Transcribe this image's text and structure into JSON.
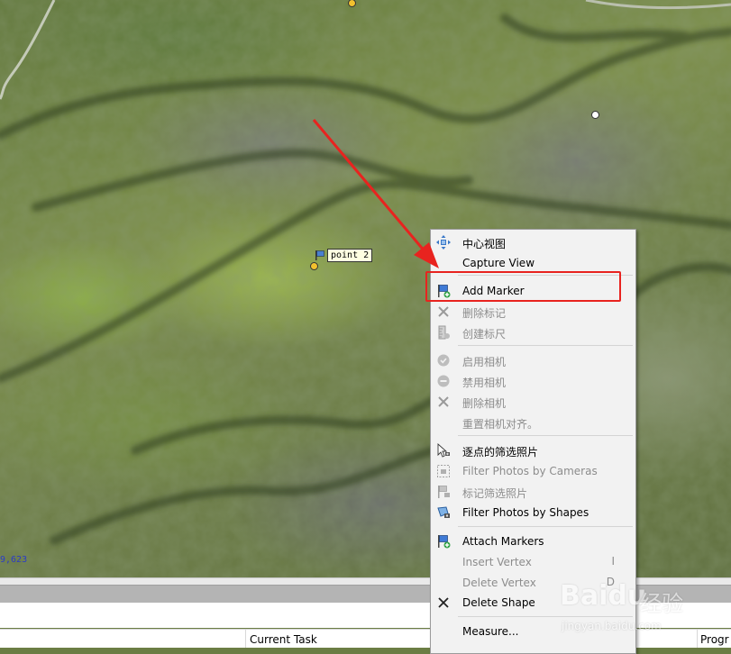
{
  "viewport": {
    "coordinate_readout": "9,623",
    "marker_label": "point 2"
  },
  "context_menu": {
    "items": [
      {
        "label": "中心视图",
        "icon": "center-view-icon",
        "enabled": true
      },
      {
        "label": "Capture View",
        "icon": "",
        "enabled": true
      },
      {
        "label": "Add Marker",
        "icon": "add-marker-icon",
        "enabled": true
      },
      {
        "label": "删除标记",
        "icon": "delete-marker-icon",
        "enabled": false
      },
      {
        "label": "创建标尺",
        "icon": "create-scale-bar-icon",
        "enabled": false
      },
      {
        "label": "启用相机",
        "icon": "enable-camera-icon",
        "enabled": false
      },
      {
        "label": "禁用相机",
        "icon": "disable-camera-icon",
        "enabled": false
      },
      {
        "label": "删除相机",
        "icon": "delete-camera-icon",
        "enabled": false
      },
      {
        "label": "重置相机对齐。",
        "icon": "",
        "enabled": false
      },
      {
        "label": "逐点的筛选照片",
        "icon": "filter-by-point-icon",
        "enabled": true
      },
      {
        "label": "Filter Photos by Cameras",
        "icon": "filter-by-cameras-icon",
        "enabled": false
      },
      {
        "label": "标记筛选照片",
        "icon": "filter-by-markers-icon",
        "enabled": false
      },
      {
        "label": "Filter Photos by Shapes",
        "icon": "filter-by-shapes-icon",
        "enabled": true
      },
      {
        "label": "Attach Markers",
        "icon": "attach-markers-icon",
        "enabled": true
      },
      {
        "label": "Insert Vertex",
        "icon": "",
        "enabled": false,
        "shortcut": "I"
      },
      {
        "label": "Delete Vertex",
        "icon": "",
        "enabled": false,
        "shortcut": "D"
      },
      {
        "label": "Delete Shape",
        "icon": "delete-shape-icon",
        "enabled": true
      },
      {
        "label": "Measure...",
        "icon": "",
        "enabled": true
      }
    ]
  },
  "status_bar": {
    "col_current_task": "Current Task",
    "col_progress": "Progr"
  },
  "watermark": {
    "logo": "Baidu",
    "text": "经验",
    "url": "jingyan.baidu.com"
  },
  "colors": {
    "annotation_red": "#e8231f",
    "menu_bg": "#f2f2f2",
    "disabled_text": "#8c8c8c",
    "label_bg": "#ffffe1"
  }
}
